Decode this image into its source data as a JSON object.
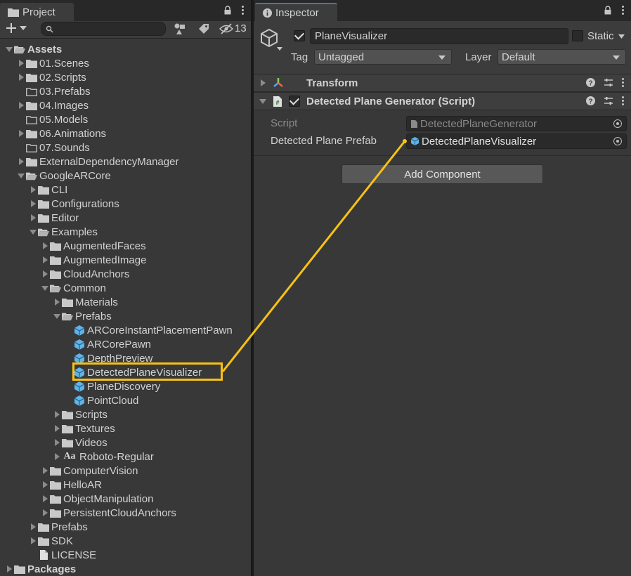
{
  "project_panel": {
    "tab_label": "Project",
    "hidden_count": "13",
    "tree": [
      {
        "label": "Assets",
        "depth": 0,
        "expanded": true,
        "icon": "folder-open-icon",
        "bold": true
      },
      {
        "label": "01.Scenes",
        "depth": 1,
        "expanded": false,
        "icon": "folder-icon"
      },
      {
        "label": "02.Scripts",
        "depth": 1,
        "expanded": false,
        "icon": "folder-icon"
      },
      {
        "label": "03.Prefabs",
        "depth": 1,
        "expanded": null,
        "icon": "folder-empty-icon"
      },
      {
        "label": "04.Images",
        "depth": 1,
        "expanded": false,
        "icon": "folder-icon"
      },
      {
        "label": "05.Models",
        "depth": 1,
        "expanded": null,
        "icon": "folder-empty-icon"
      },
      {
        "label": "06.Animations",
        "depth": 1,
        "expanded": false,
        "icon": "folder-icon"
      },
      {
        "label": "07.Sounds",
        "depth": 1,
        "expanded": null,
        "icon": "folder-empty-icon"
      },
      {
        "label": "ExternalDependencyManager",
        "depth": 1,
        "expanded": false,
        "icon": "folder-icon"
      },
      {
        "label": "GoogleARCore",
        "depth": 1,
        "expanded": true,
        "icon": "folder-open-icon"
      },
      {
        "label": "CLI",
        "depth": 2,
        "expanded": false,
        "icon": "folder-icon"
      },
      {
        "label": "Configurations",
        "depth": 2,
        "expanded": false,
        "icon": "folder-icon"
      },
      {
        "label": "Editor",
        "depth": 2,
        "expanded": false,
        "icon": "folder-icon"
      },
      {
        "label": "Examples",
        "depth": 2,
        "expanded": true,
        "icon": "folder-open-icon"
      },
      {
        "label": "AugmentedFaces",
        "depth": 3,
        "expanded": false,
        "icon": "folder-icon"
      },
      {
        "label": "AugmentedImage",
        "depth": 3,
        "expanded": false,
        "icon": "folder-icon"
      },
      {
        "label": "CloudAnchors",
        "depth": 3,
        "expanded": false,
        "icon": "folder-icon"
      },
      {
        "label": "Common",
        "depth": 3,
        "expanded": true,
        "icon": "folder-open-icon"
      },
      {
        "label": "Materials",
        "depth": 4,
        "expanded": false,
        "icon": "folder-icon"
      },
      {
        "label": "Prefabs",
        "depth": 4,
        "expanded": true,
        "icon": "folder-open-icon"
      },
      {
        "label": "ARCoreInstantPlacementPawn",
        "depth": 5,
        "expanded": null,
        "icon": "prefab-icon"
      },
      {
        "label": "ARCorePawn",
        "depth": 5,
        "expanded": null,
        "icon": "prefab-icon"
      },
      {
        "label": "DepthPreview",
        "depth": 5,
        "expanded": null,
        "icon": "prefab-icon"
      },
      {
        "label": "DetectedPlaneVisualizer",
        "depth": 5,
        "expanded": null,
        "icon": "prefab-icon",
        "highlighted": true
      },
      {
        "label": "PlaneDiscovery",
        "depth": 5,
        "expanded": null,
        "icon": "prefab-icon"
      },
      {
        "label": "PointCloud",
        "depth": 5,
        "expanded": null,
        "icon": "prefab-icon"
      },
      {
        "label": "Scripts",
        "depth": 4,
        "expanded": false,
        "icon": "folder-icon"
      },
      {
        "label": "Textures",
        "depth": 4,
        "expanded": false,
        "icon": "folder-icon"
      },
      {
        "label": "Videos",
        "depth": 4,
        "expanded": false,
        "icon": "folder-icon"
      },
      {
        "label": "Roboto-Regular",
        "depth": 4,
        "expanded": false,
        "icon": "font-asset-icon"
      },
      {
        "label": "ComputerVision",
        "depth": 3,
        "expanded": false,
        "icon": "folder-icon"
      },
      {
        "label": "HelloAR",
        "depth": 3,
        "expanded": false,
        "icon": "folder-icon"
      },
      {
        "label": "ObjectManipulation",
        "depth": 3,
        "expanded": false,
        "icon": "folder-icon"
      },
      {
        "label": "PersistentCloudAnchors",
        "depth": 3,
        "expanded": false,
        "icon": "folder-icon"
      },
      {
        "label": "Prefabs",
        "depth": 2,
        "expanded": false,
        "icon": "folder-icon"
      },
      {
        "label": "SDK",
        "depth": 2,
        "expanded": false,
        "icon": "folder-icon"
      },
      {
        "label": "LICENSE",
        "depth": 2,
        "expanded": null,
        "icon": "file-icon"
      },
      {
        "label": "Packages",
        "depth": 0,
        "expanded": false,
        "icon": "folder-icon",
        "bold": true
      }
    ]
  },
  "inspector": {
    "tab_label": "Inspector",
    "object_name": "PlaneVisualizer",
    "static_label": "Static",
    "tag_label": "Tag",
    "tag_value": "Untagged",
    "layer_label": "Layer",
    "layer_value": "Default",
    "transform_title": "Transform",
    "component_title": "Detected Plane Generator (Script)",
    "script_label": "Script",
    "script_value": "DetectedPlaneGenerator",
    "prefab_label": "Detected Plane Prefab",
    "prefab_value": "DetectedPlaneVisualizer",
    "add_component_label": "Add Component"
  },
  "colors": {
    "highlight": "#f8c215",
    "prefab_blue": "#5fb4e8",
    "folder": "#c8c8c8"
  }
}
